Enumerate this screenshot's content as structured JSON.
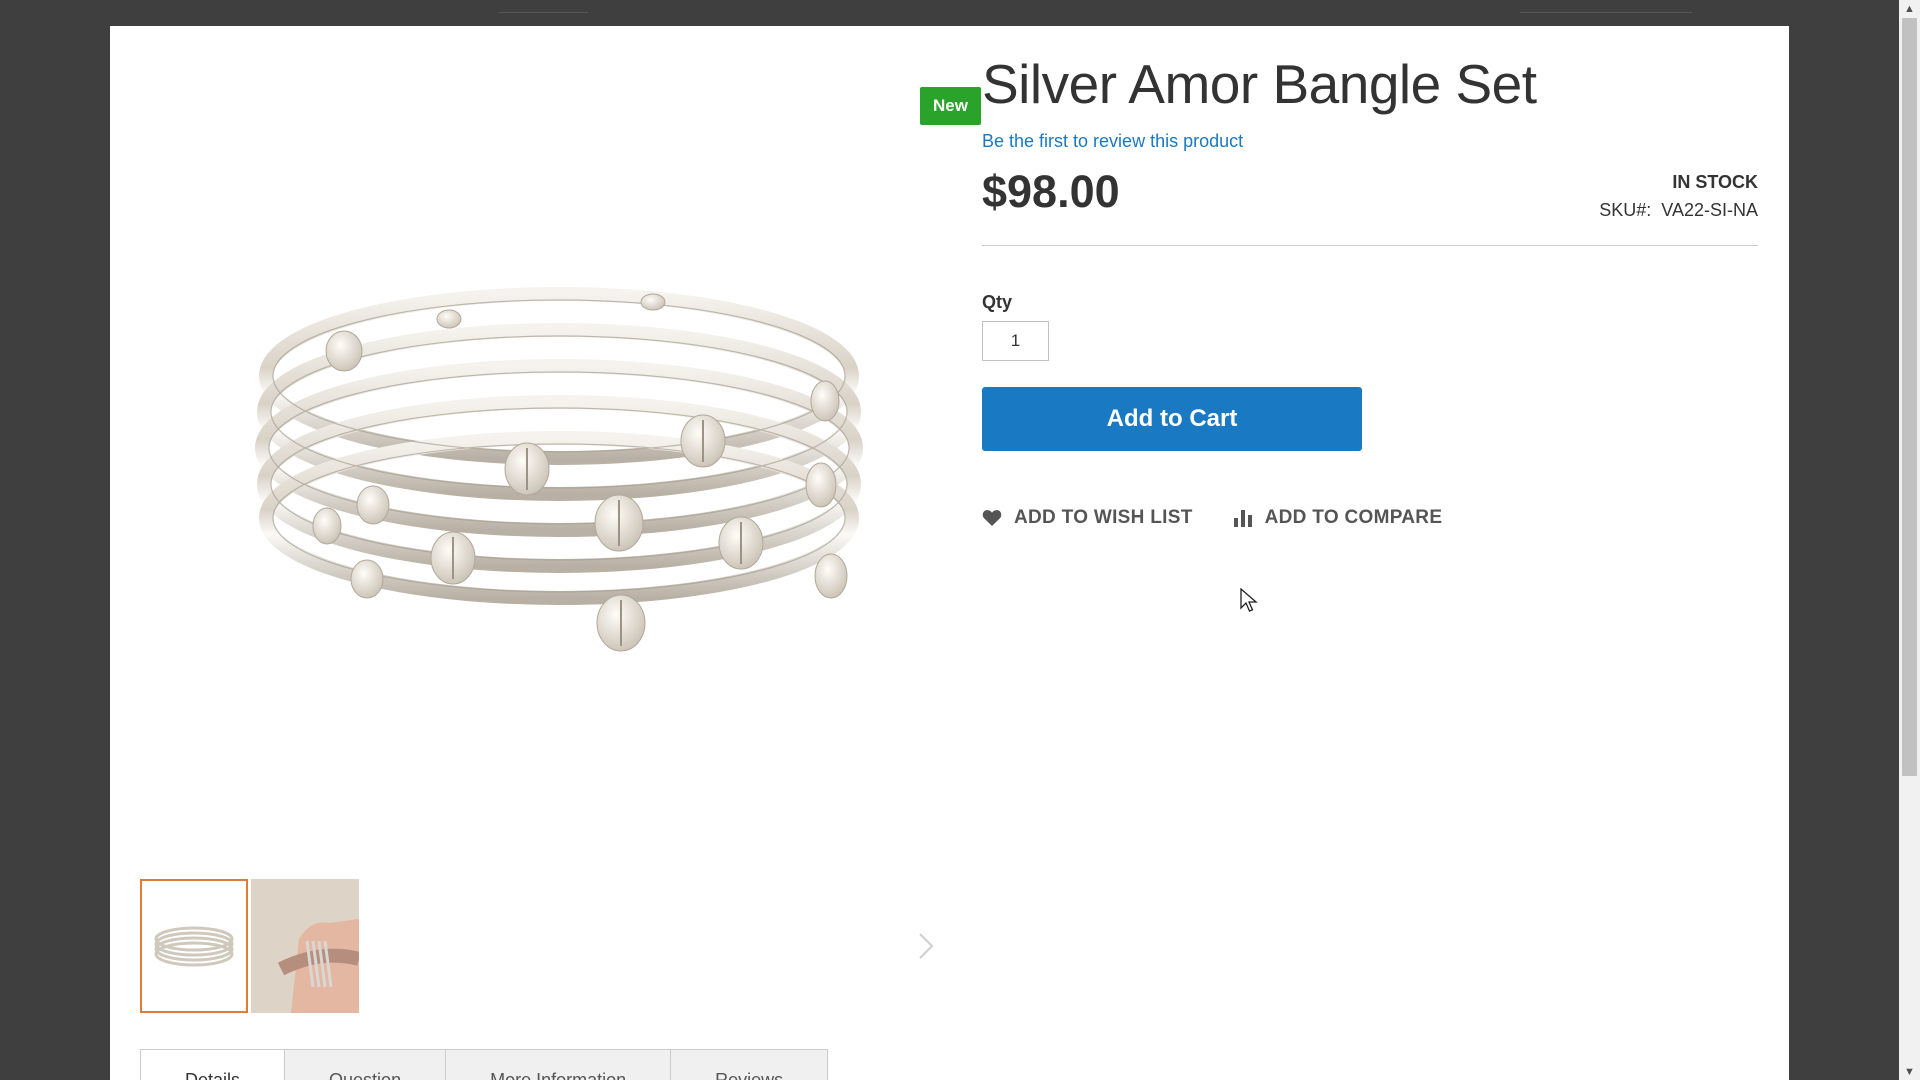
{
  "product": {
    "badge": "New",
    "title": "Silver Amor Bangle Set",
    "review_link": "Be the first to review this product",
    "price": "$98.00",
    "stock": "IN STOCK",
    "sku_label": "SKU#:",
    "sku_value": "VA22-SI-NA"
  },
  "purchase": {
    "qty_label": "Qty",
    "qty_value": "1",
    "add_to_cart": "Add to Cart"
  },
  "actions": {
    "wishlist": "ADD TO WISH LIST",
    "compare": "ADD TO COMPARE"
  },
  "tabs": [
    {
      "label": "Details",
      "active": true
    },
    {
      "label": "Question"
    },
    {
      "label": "More Information"
    },
    {
      "label": "Reviews"
    }
  ],
  "colors": {
    "accent": "#1979c3",
    "badge": "#29a329",
    "thumb_active": "#e07b39"
  },
  "icons": [
    "heart-icon",
    "bar-chart-icon",
    "chevron-right-icon",
    "mouse-cursor-icon"
  ]
}
